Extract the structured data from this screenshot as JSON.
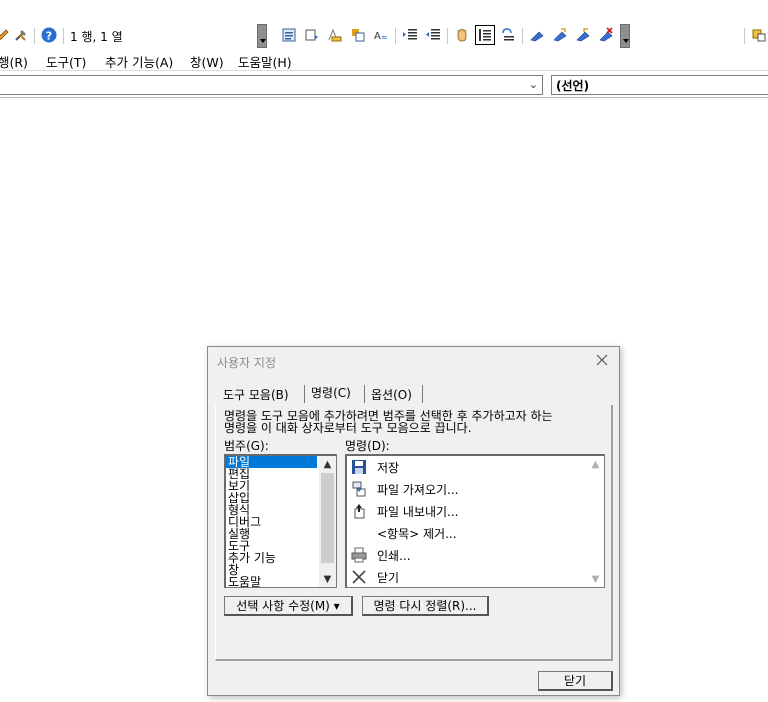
{
  "toolbar": {
    "position_text": "1 행, 1 열"
  },
  "menu": {
    "items": [
      "행(R)",
      "도구(T)",
      "추가 기능(A)",
      "창(W)",
      "도움말(H)"
    ]
  },
  "procedure_combo": {
    "value": "(선언)"
  },
  "dialog": {
    "title": "사용자 지정",
    "tabs": [
      "도구 모음(B)",
      "명령(C)",
      "옵션(O)"
    ],
    "active_tab": "명령(C)",
    "description_line1": "명령을 도구 모음에 추가하려면 범주를 선택한 후 추가하고자 하는",
    "description_line2": "명령을 이 대화 상자로부터 도구 모음으로 끕니다.",
    "categories_label": "범주(G):",
    "commands_label": "명령(D):",
    "categories": [
      "파일",
      "편집",
      "보기",
      "삽입",
      "형식",
      "디버그",
      "실행",
      "도구",
      "추가 기능",
      "창",
      "도움말"
    ],
    "selected_category": "파일",
    "commands": [
      {
        "label": "저장",
        "icon": "save-icon"
      },
      {
        "label": "파일 가져오기...",
        "icon": "import-file-icon"
      },
      {
        "label": "파일 내보내기...",
        "icon": "export-file-icon"
      },
      {
        "label": "<항목> 제거...",
        "icon": ""
      },
      {
        "label": "인쇄...",
        "icon": "print-icon"
      },
      {
        "label": "닫기",
        "icon": "close-x-icon"
      }
    ],
    "modify_selection_label": "선택 사항 수정(M) ▾",
    "rearrange_commands_label": "명령 다시 정렬(R)...",
    "close_label": "닫기"
  }
}
